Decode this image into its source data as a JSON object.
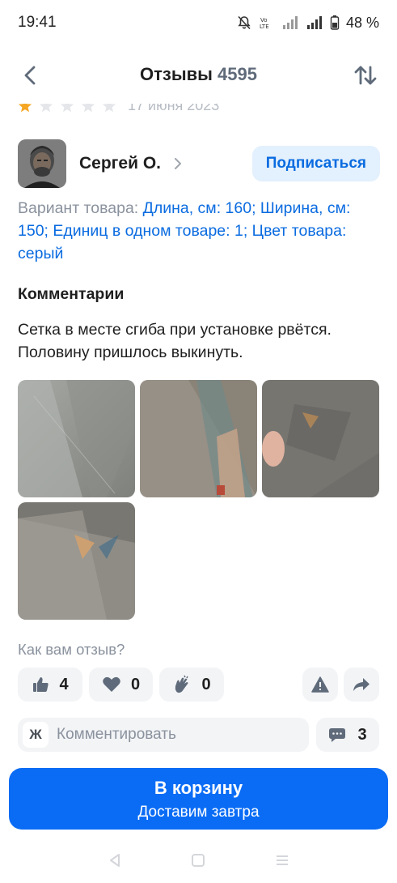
{
  "status_bar": {
    "time": "19:41",
    "battery": "48 %",
    "icons": [
      "mute-icon",
      "volte-icon",
      "signal-icon",
      "signal-icon",
      "battery-icon"
    ]
  },
  "header": {
    "title": "Отзывы",
    "count": "4595"
  },
  "previous_review": {
    "rating": 1,
    "date": "17 июня 2023"
  },
  "review": {
    "author": "Сергей О.",
    "subscribe_label": "Подписаться",
    "variant_label": "Вариант товара: ",
    "variant_value": "Длина, см: 160; Ширина, см: 150; Единиц в одном товаре: 1; Цвет товара: серый",
    "comments_heading": "Комментарии",
    "comment_text": "Сетка в месте сгиба при установке рвётся. Половину пришлось выкинуть.",
    "photo_count": 4
  },
  "feedback": {
    "question": "Как вам отзыв?",
    "likes": "4",
    "hearts": "0",
    "claps": "0"
  },
  "comment_bar": {
    "keyboard_letter": "Ж",
    "placeholder": "Комментировать",
    "comments_count": "3"
  },
  "cart": {
    "label": "В корзину",
    "delivery": "Доставим завтра"
  },
  "colors": {
    "accent": "#0a6cf5",
    "link": "#0a6be0",
    "muted": "#8a929e",
    "chip_bg": "#f3f4f6"
  }
}
